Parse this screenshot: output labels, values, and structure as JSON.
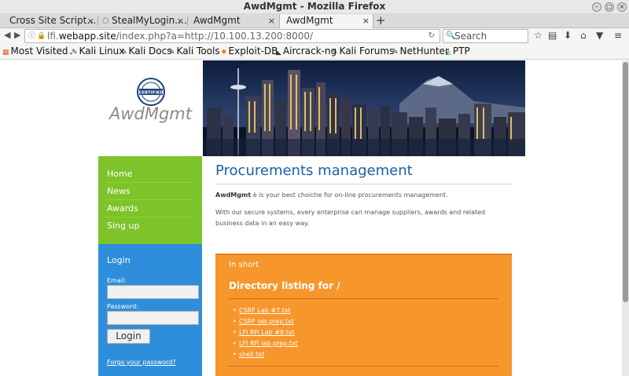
{
  "window": {
    "title": "AwdMgmt - Mozilla Firefox"
  },
  "tabs": [
    {
      "label": "Cross Site Script…"
    },
    {
      "label": "StealMyLogin.…"
    },
    {
      "label": "AwdMgmt"
    },
    {
      "label": "AwdMgmt"
    }
  ],
  "navbar": {
    "url_host": "lfi.webapp.site",
    "url_prefix": "lfi.",
    "url_domain": "webapp.site",
    "url_path": "/index.php?a=http://10.100.13.200:8000/",
    "search_placeholder": "Search"
  },
  "bookmarks": [
    {
      "label": "Most Visited"
    },
    {
      "label": "Kali Linux"
    },
    {
      "label": "Kali Docs"
    },
    {
      "label": "Kali Tools"
    },
    {
      "label": "Exploit-DB"
    },
    {
      "label": "Aircrack-ng"
    },
    {
      "label": "Kali Forums"
    },
    {
      "label": "NetHunter"
    },
    {
      "label": "PTP"
    }
  ],
  "site": {
    "logo_text": "AwdMgmt",
    "badge_text": "CERTIFIED",
    "nav": [
      "Home",
      "News",
      "Awards",
      "Sing up"
    ],
    "login": {
      "title": "Login",
      "email_label": "Email:",
      "password_label": "Password:",
      "button": "Login",
      "forgot": "Forgo your password?"
    },
    "heading": "Procurements management",
    "intro_bold": "AwdMgmt",
    "intro_rest": " è is your best choiche for on-line procurements management.",
    "paragraph2": "With our secure systems, every enterprise can manage suppliers, awards and related business data in an easy way.",
    "box": {
      "short": "In short",
      "dir_heading": "Directory listing for /",
      "files": [
        "CSRF Lab #7.txt",
        "CSRF lab prep.txt",
        "LFI RFi Lab #8.txt",
        "LFI RFi lab prep.txt",
        "shell.txt"
      ]
    }
  },
  "colors": {
    "nav_green": "#7dc32a",
    "login_blue": "#2e8edb",
    "orange": "#f7962b",
    "heading_blue": "#1f5fa3"
  }
}
